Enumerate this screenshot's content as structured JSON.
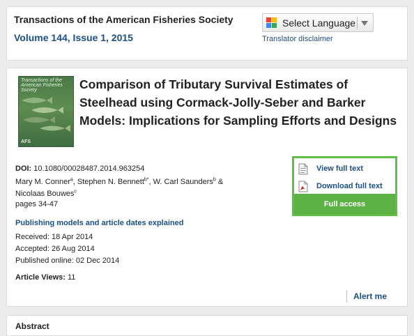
{
  "header": {
    "journal_title": "Transactions of the American Fisheries Society",
    "volume_issue": "Volume 144, Issue 1, 2015",
    "language_select": "Select Language",
    "translator_disclaimer": "Translator disclaimer"
  },
  "cover": {
    "title": "Transactions of the American Fisheries Society",
    "logo": "AFS"
  },
  "article": {
    "title": "Comparison of Tributary Survival Estimates of Steelhead using Cormack-Jolly-Seber and Barker Models: Implications for Sampling Efforts and Designs",
    "doi_label": "DOI:",
    "doi_value": " 10.1080/00028487.2014.963254",
    "authors": [
      {
        "name": "Mary M. Conner",
        "sup": "a",
        "sep": ", "
      },
      {
        "name": "Stephen N. Bennett",
        "sup": "b*",
        "sep": ", "
      },
      {
        "name": "W. Carl Saunders",
        "sup": "b",
        "sep": " & "
      },
      {
        "name": "Nicolaas Bouwes",
        "sup": "c",
        "sep": ""
      }
    ],
    "pages": "pages 34-47",
    "models_link": "Publishing models and article dates explained",
    "received": "Received: 18 Apr 2014",
    "accepted": "Accepted: 26 Aug 2014",
    "published": "Published online: 02 Dec 2014",
    "views_label": "Article Views:",
    "views_value": " 11"
  },
  "access": {
    "view_full_text": "View full text",
    "download_full_text": "Download full text",
    "full_access": "Full access"
  },
  "alert": "Alert me",
  "abstract_heading": "Abstract",
  "colors": {
    "link": "#1a4f8a",
    "access_green": "#5cb343",
    "background": "#ececec"
  }
}
